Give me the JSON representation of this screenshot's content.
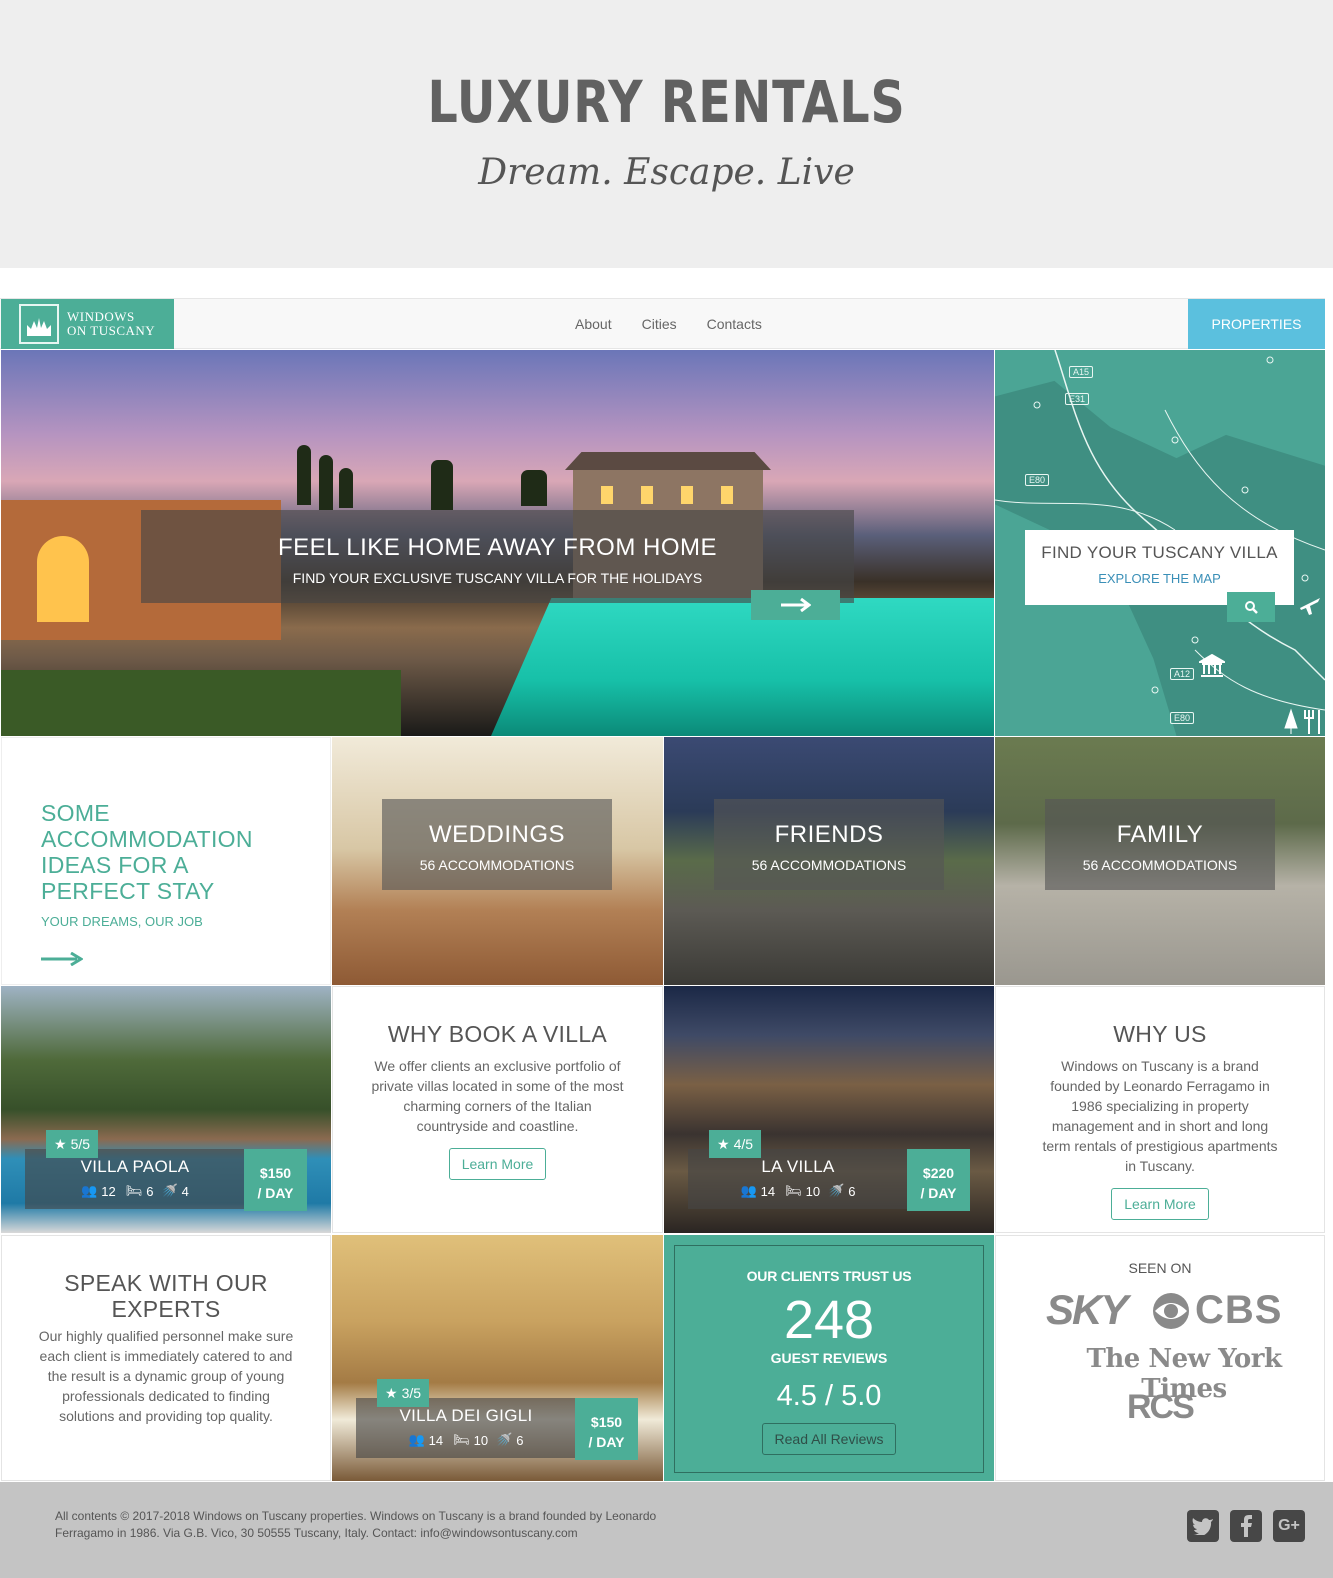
{
  "banner": {
    "title": "LUXURY RENTALS",
    "tagline": "Dream. Escape. Live"
  },
  "nav": {
    "logo_line1": "WINDOWS",
    "logo_line2": "ON TUSCANY",
    "links": [
      "About",
      "Cities",
      "Contacts"
    ],
    "cta": "PROPERTIES"
  },
  "hero": {
    "heading": "FEEL LIKE HOME AWAY FROM HOME",
    "subheading": "FIND YOUR EXCLUSIVE TUSCANY VILLA FOR THE HOLIDAYS",
    "button_icon": "arrow-right-icon"
  },
  "map_card": {
    "heading": "FIND YOUR TUSCANY VILLA",
    "link": "EXPLORE THE MAP",
    "button_icon": "search-icon",
    "road_labels": [
      "A15",
      "E31",
      "E80",
      "A12",
      "E80"
    ]
  },
  "ideas": {
    "heading": "SOME ACCOMMODATION IDEAS FOR A PERFECT STAY",
    "subheading": "YOUR DREAMS, OUR JOB"
  },
  "categories": [
    {
      "title": "WEDDINGS",
      "count": "56 ACCOMMODATIONS"
    },
    {
      "title": "FRIENDS",
      "count": "56 ACCOMMODATIONS"
    },
    {
      "title": "FAMILY",
      "count": "56 ACCOMMODATIONS"
    }
  ],
  "villas": [
    {
      "name": "VILLA PAOLA",
      "rating": "5/5",
      "guests": "12",
      "beds": "6",
      "baths": "4",
      "price_line1": "$150",
      "price_line2": "/ DAY"
    },
    {
      "name": "LA VILLA",
      "rating": "4/5",
      "guests": "14",
      "beds": "10",
      "baths": "6",
      "price_line1": "$220",
      "price_line2": "/ DAY"
    },
    {
      "name": "VILLA DEI GIGLI",
      "rating": "3/5",
      "guests": "14",
      "beds": "10",
      "baths": "6",
      "price_line1": "$150",
      "price_line2": "/ DAY"
    }
  ],
  "why_book": {
    "heading": "WHY BOOK A VILLA",
    "body": "We offer clients an exclusive portfolio of private villas located in some of the most charming corners of the Italian countryside and coastline.",
    "button": "Learn More"
  },
  "why_us": {
    "heading": "WHY US",
    "body": "Windows on Tuscany is a brand founded by Leonardo Ferragamo in 1986 specializing in property management and in short and long term rentals of prestigious apartments in Tuscany.",
    "button": "Learn More"
  },
  "speak": {
    "heading": "SPEAK WITH OUR EXPERTS",
    "body": "Our highly qualified personnel make sure each client is immediately catered to and the result is a dynamic group of young professionals dedicated to finding solutions and providing top quality."
  },
  "trust": {
    "heading": "OUR CLIENTS TRUST US",
    "count": "248",
    "count_label": "GUEST REVIEWS",
    "rating": "4.5 / 5.0",
    "button": "Read All Reviews"
  },
  "seen_on": {
    "heading": "SEEN ON",
    "brands": [
      "SKY",
      "CBS",
      "The New York Times",
      "RCS"
    ]
  },
  "footer": {
    "text": "All contents © 2017-2018 Windows on Tuscany properties. Windows on Tuscany is a brand founded by Leonardo Ferragamo in 1986. Via G.B. Vico, 30 50555 Tuscany, Italy. Contact: info@windowsontuscany.com",
    "social": [
      "twitter-icon",
      "facebook-icon",
      "google-plus-icon"
    ]
  },
  "colors": {
    "accent": "#4cae97",
    "nav_cta": "#5bc0de",
    "banner_bg": "#eeeeee",
    "footer_bg": "#c4c4c4"
  }
}
